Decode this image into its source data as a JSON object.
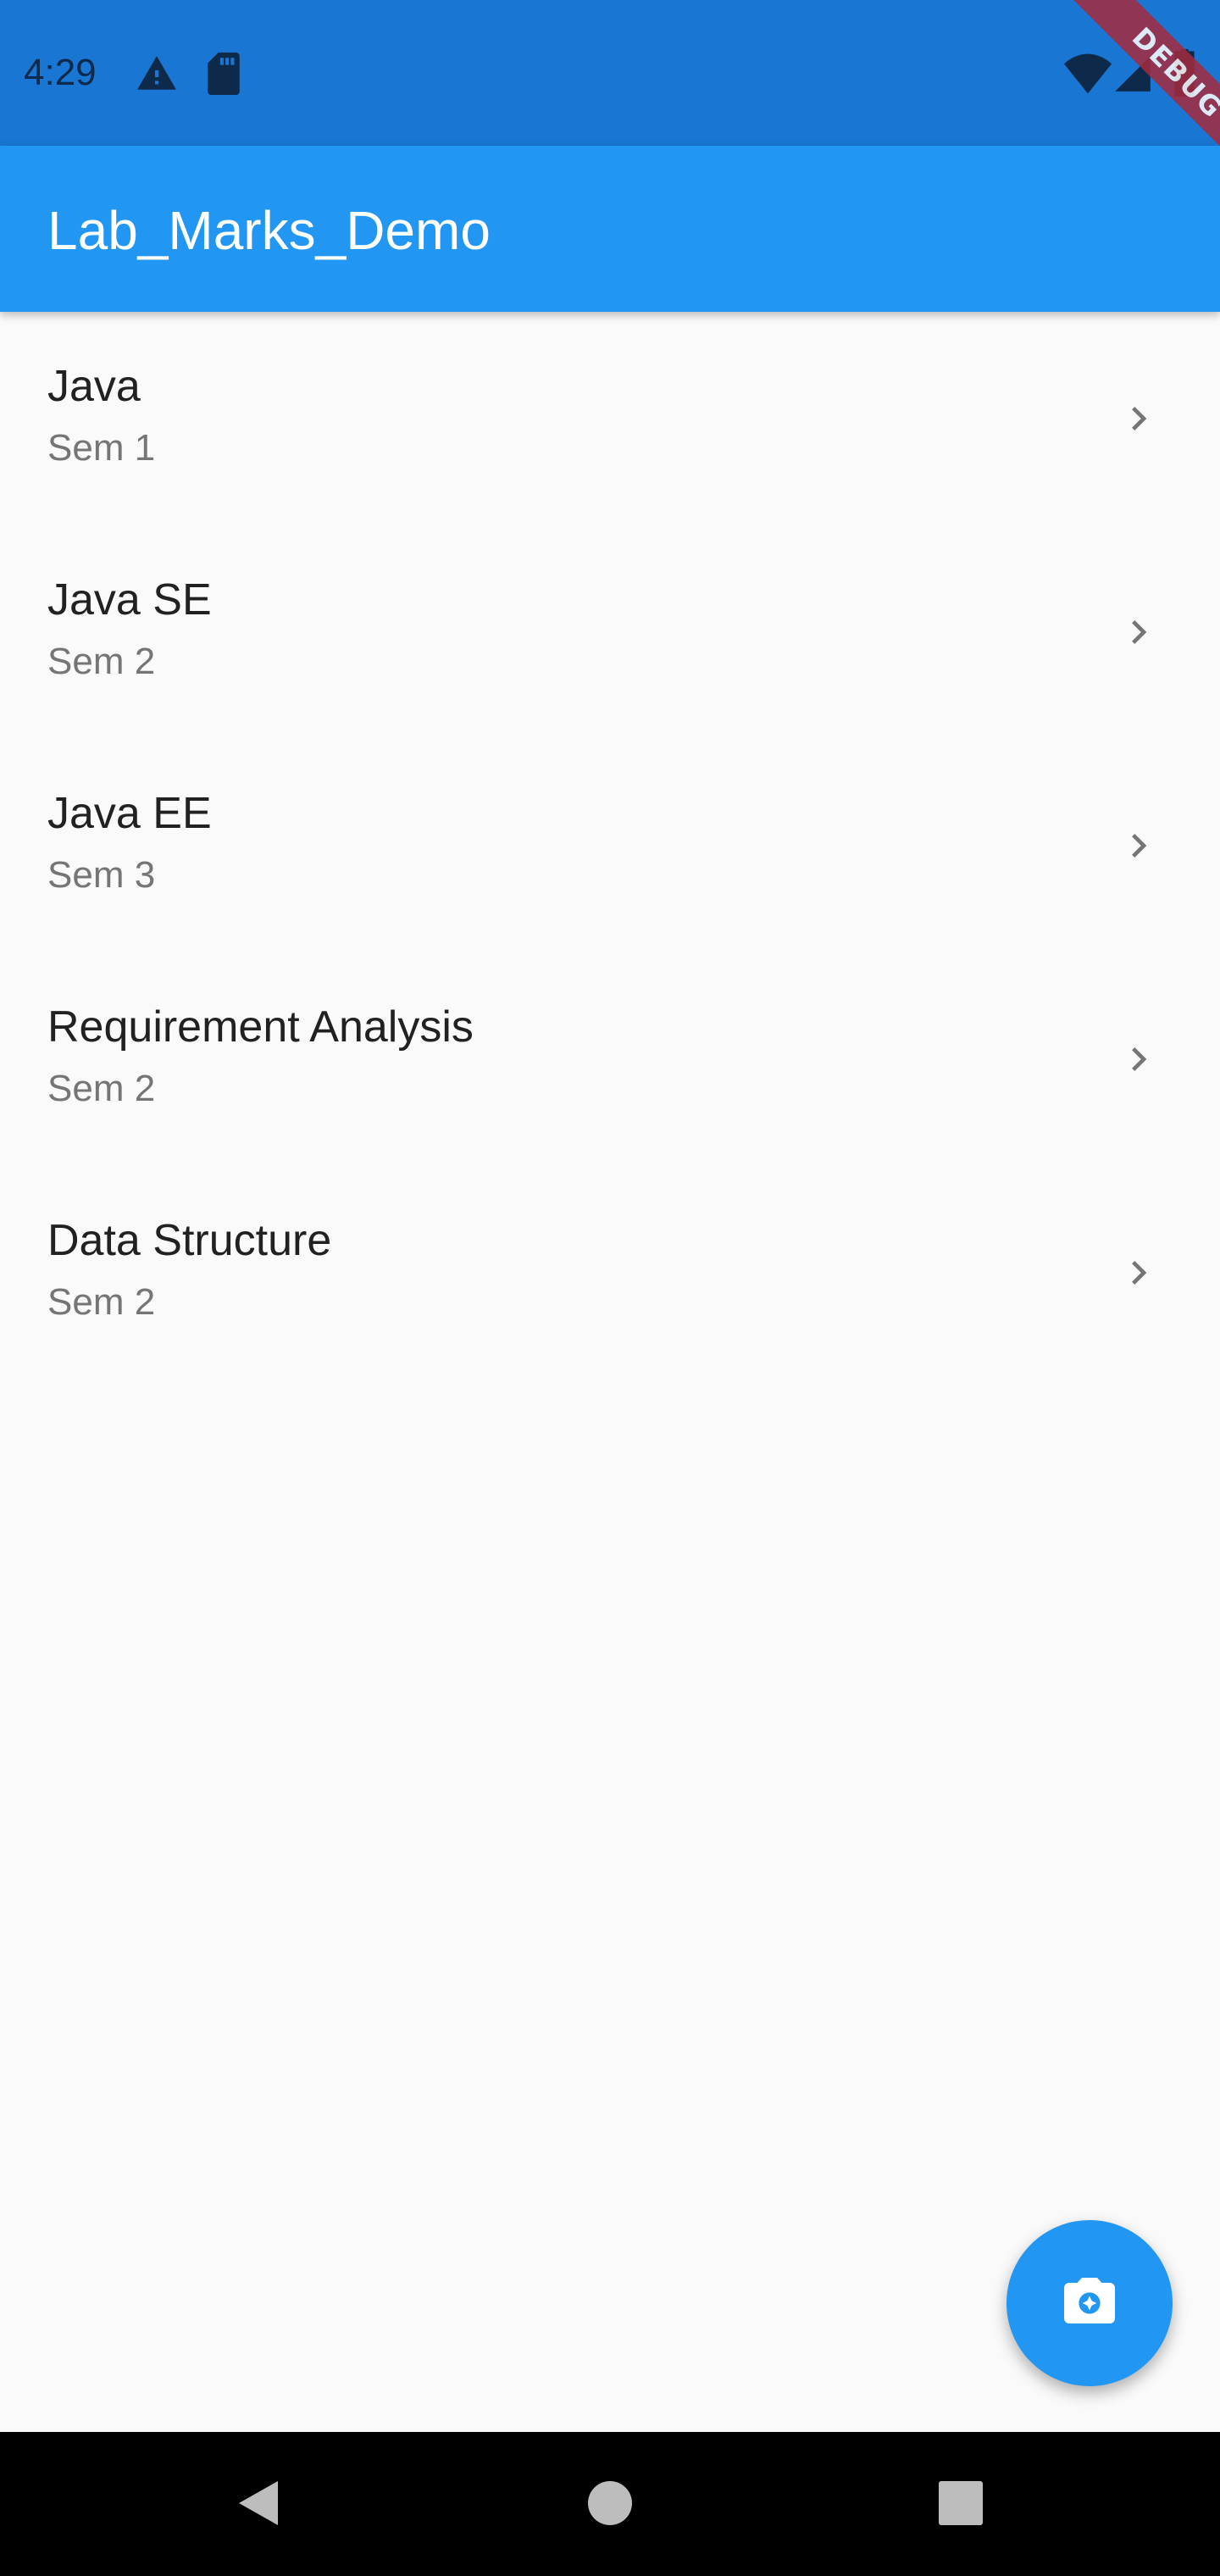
{
  "status_bar": {
    "time": "4:29",
    "icons": [
      "warning-icon",
      "sd-card-icon",
      "wifi-icon",
      "signal-icon",
      "battery-icon"
    ],
    "color": "#1976d2"
  },
  "debug_banner": "DEBUG",
  "app_bar": {
    "title": "Lab_Marks_Demo",
    "color": "#2196f3"
  },
  "courses": [
    {
      "title": "Java",
      "subtitle": "Sem 1"
    },
    {
      "title": "Java SE",
      "subtitle": "Sem 2"
    },
    {
      "title": "Java EE",
      "subtitle": "Sem 3"
    },
    {
      "title": "Requirement Analysis",
      "subtitle": "Sem 2"
    },
    {
      "title": "Data Structure",
      "subtitle": "Sem 2"
    }
  ],
  "fab": {
    "icon": "camera-icon",
    "color": "#2196f3"
  },
  "nav_bar": {
    "icons": [
      "back-icon",
      "home-icon",
      "recents-icon"
    ]
  }
}
